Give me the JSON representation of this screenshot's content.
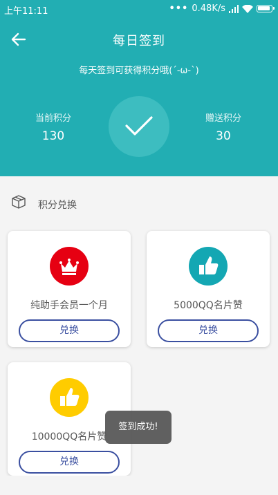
{
  "status_bar": {
    "time": "上午11:11",
    "network_speed": "0.48K/s"
  },
  "header": {
    "title": "每日签到",
    "subtitle": "每天签到可获得积分哦(´-ω-`)",
    "current_points_label": "当前积分",
    "current_points_value": "130",
    "bonus_points_label": "赠送积分",
    "bonus_points_value": "30",
    "checked_in": true
  },
  "section": {
    "title": "积分兑换"
  },
  "rewards": [
    {
      "name": "纯助手会员一个月",
      "button": "兑换",
      "icon": "crown-icon",
      "color": "#e60012"
    },
    {
      "name": "5000QQ名片赞",
      "button": "兑换",
      "icon": "thumbs-up-icon",
      "color": "#14a7b3"
    },
    {
      "name": "10000QQ名片赞",
      "button": "兑换",
      "icon": "thumbs-up-icon",
      "color": "#ffcc00"
    }
  ],
  "toast": {
    "message": "签到成功!"
  },
  "colors": {
    "primary": "#22aeb3",
    "button_border": "#3a4fa0"
  }
}
